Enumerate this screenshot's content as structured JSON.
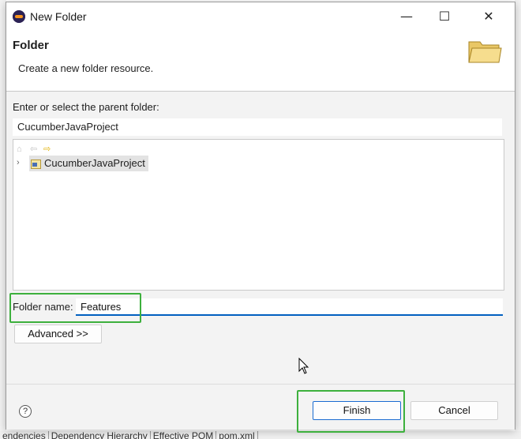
{
  "window": {
    "title": "New Folder",
    "minimize_glyph": "—",
    "maximize_glyph": "☐",
    "close_glyph": "✕"
  },
  "header": {
    "title": "Folder",
    "description": "Create a new folder resource."
  },
  "parent_folder": {
    "label": "Enter or select the parent folder:",
    "value": "CucumberJavaProject"
  },
  "tree": {
    "items": [
      {
        "label": "CucumberJavaProject",
        "expanded": false,
        "selected": true
      }
    ]
  },
  "folder_name": {
    "label": "Folder name:",
    "value": "Features"
  },
  "buttons": {
    "advanced": "Advanced >>",
    "finish": "Finish",
    "cancel": "Cancel",
    "help": "?"
  },
  "background_ide": {
    "bottom_tabs": [
      "endencies",
      "Dependency Hierarchy",
      "Effective POM",
      "pom.xml"
    ]
  },
  "colors": {
    "highlight_green": "#3db03d",
    "focus_blue": "#0060c0",
    "dialog_bg": "#f3f3f3"
  }
}
